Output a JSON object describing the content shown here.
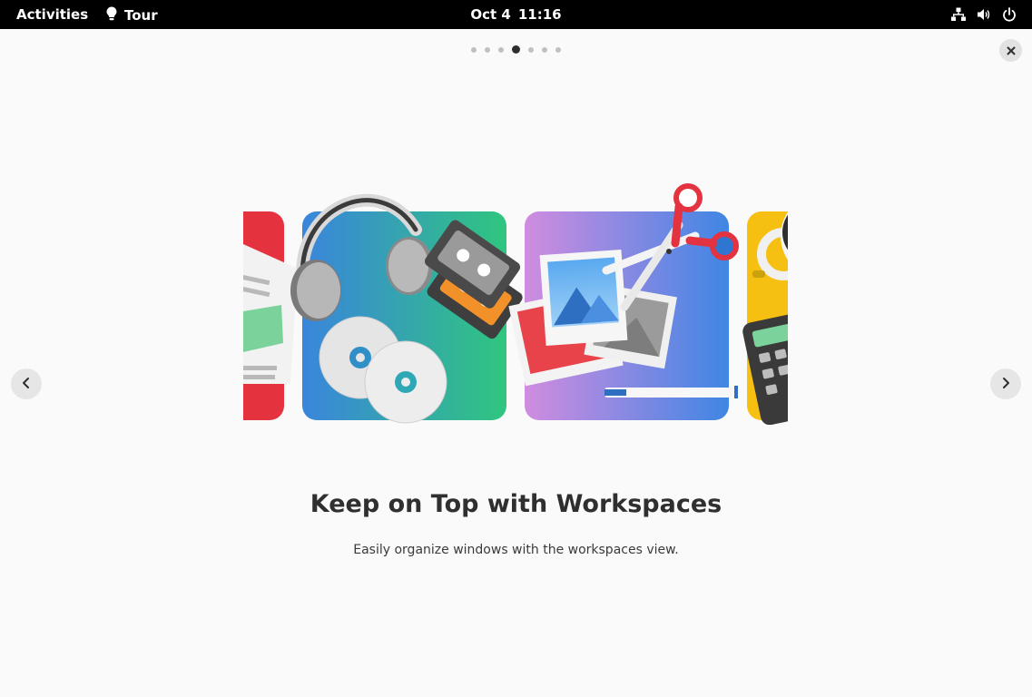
{
  "topbar": {
    "activities_label": "Activities",
    "app_name": "Tour",
    "date": "Oct 4",
    "time": "11:16",
    "icons": [
      "network-icon",
      "volume-icon",
      "power-icon"
    ]
  },
  "pager": {
    "total": 7,
    "active_index": 3
  },
  "slide": {
    "title": "Keep on Top with Workspaces",
    "description": "Easily organize windows with the workspaces view."
  },
  "illustration": {
    "tiles": [
      "documents-tile",
      "music-media-tile",
      "photos-edit-tile",
      "utilities-tile"
    ],
    "colors": {
      "red": "#e5323f",
      "music_gradient_start": "#3a85dc",
      "music_gradient_end": "#2fc67e",
      "photo_gradient_start": "#d08ce0",
      "photo_gradient_end": "#3f86e4",
      "yellow": "#f6c012"
    }
  },
  "icons": {
    "close": "close-icon",
    "prev": "chevron-left-icon",
    "next": "chevron-right-icon",
    "app": "lightbulb-icon"
  }
}
